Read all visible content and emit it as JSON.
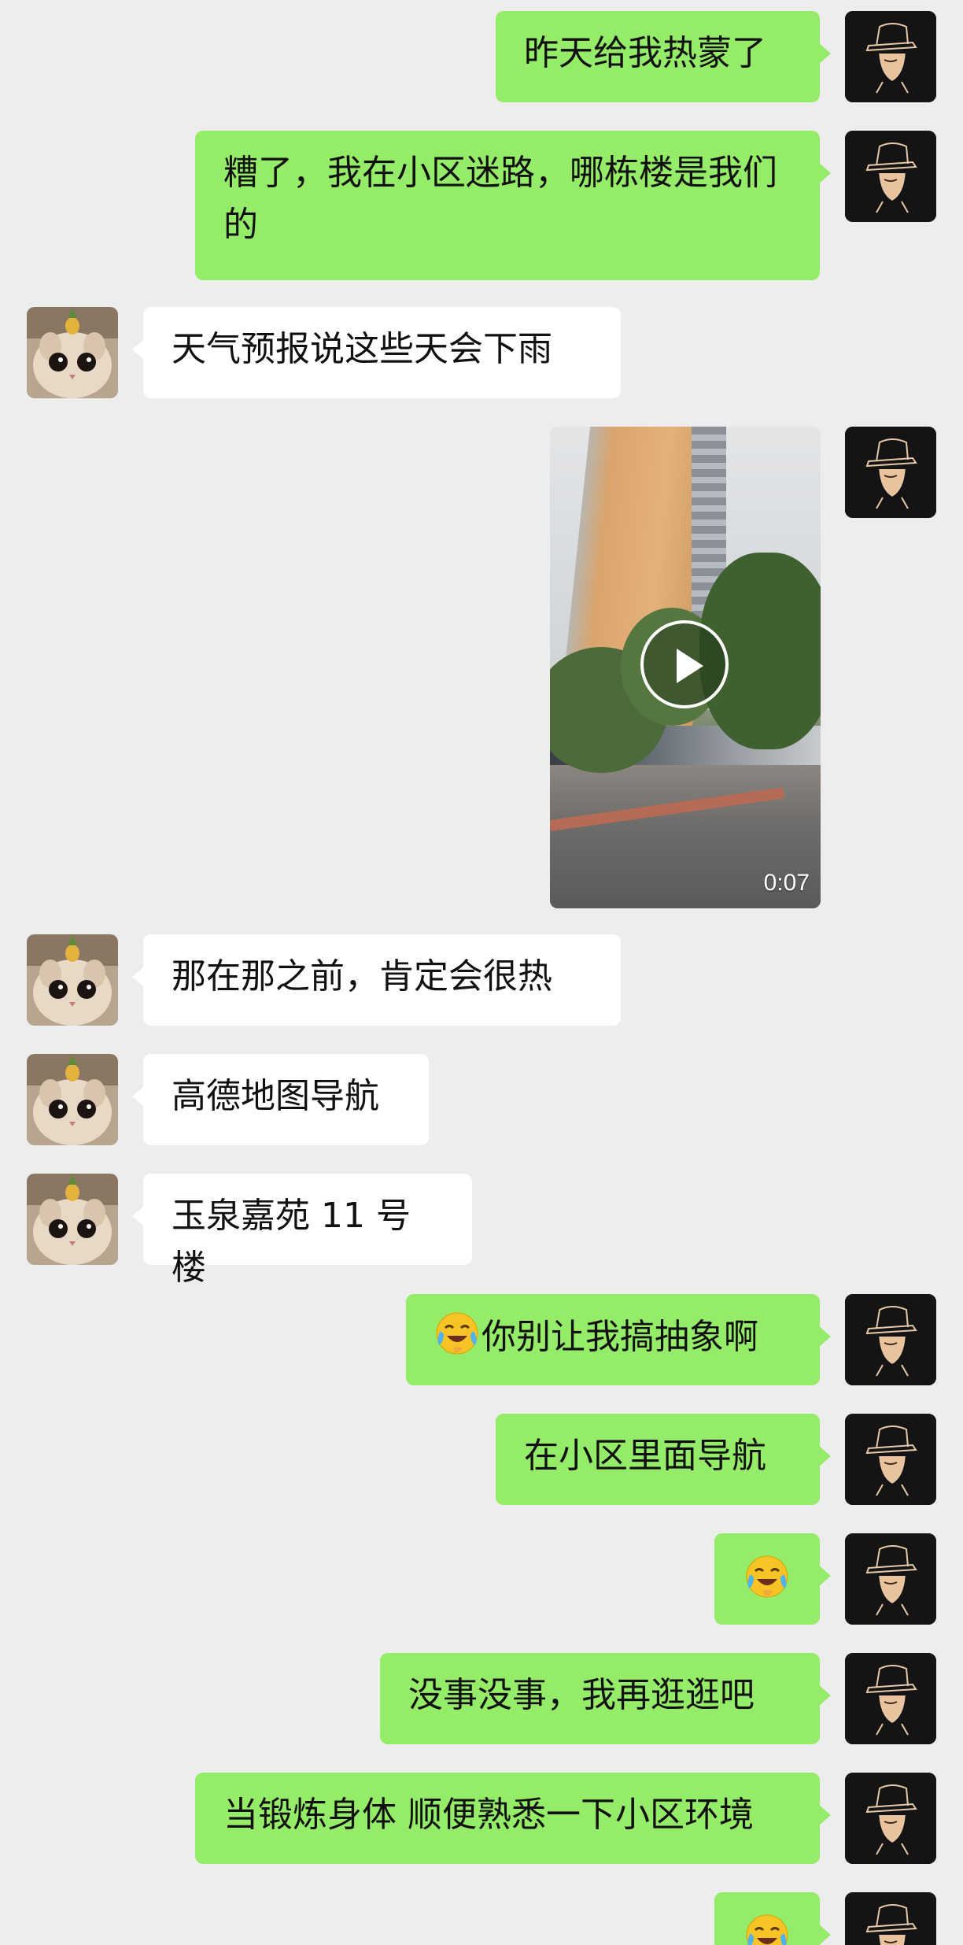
{
  "messages": [
    {
      "side": "right",
      "type": "text",
      "text": "昨天给我热蒙了"
    },
    {
      "side": "right",
      "type": "text",
      "text": "糟了，我在小区迷路，哪栋楼是我们的"
    },
    {
      "side": "left",
      "type": "text",
      "text": "天气预报说这些天会下雨"
    },
    {
      "side": "right",
      "type": "video",
      "duration": "0:07"
    },
    {
      "side": "left",
      "type": "text",
      "text": "那在那之前，肯定会很热"
    },
    {
      "side": "left",
      "type": "text",
      "text": "高德地图导航"
    },
    {
      "side": "left",
      "type": "text",
      "text": "玉泉嘉苑 11 号楼"
    },
    {
      "side": "right",
      "type": "text",
      "emoji": "laugh-cry",
      "text": "你别让我搞抽象啊"
    },
    {
      "side": "right",
      "type": "text",
      "text": "在小区里面导航"
    },
    {
      "side": "right",
      "type": "emoji",
      "emoji": "laugh-cry"
    },
    {
      "side": "right",
      "type": "text",
      "text": "没事没事，我再逛逛吧"
    },
    {
      "side": "right",
      "type": "text",
      "text": "当锻炼身体 顺便熟悉一下小区环境"
    },
    {
      "side": "right",
      "type": "emoji",
      "emoji": "laugh-cry"
    }
  ],
  "avatars": {
    "self": "detective-hat-avatar",
    "friend": "cat-pineapple-avatar"
  },
  "colors": {
    "background": "#ededed",
    "bubble_self": "#95ec69",
    "bubble_friend": "#ffffff"
  }
}
